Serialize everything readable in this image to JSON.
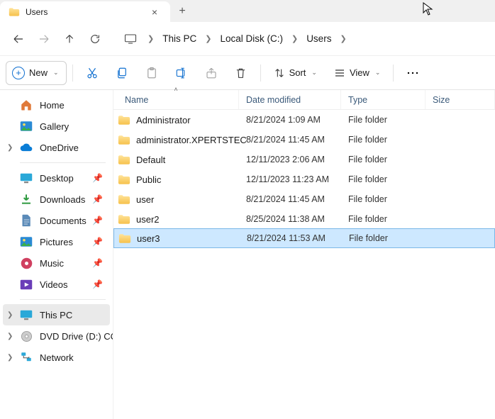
{
  "tab": {
    "title": "Users"
  },
  "breadcrumb": {
    "thispc": "This PC",
    "drive": "Local Disk (C:)",
    "folder": "Users"
  },
  "toolbar": {
    "new": "New",
    "sort": "Sort",
    "view": "View"
  },
  "sidebar": {
    "home": "Home",
    "gallery": "Gallery",
    "onedrive": "OneDrive",
    "desktop": "Desktop",
    "downloads": "Downloads",
    "documents": "Documents",
    "pictures": "Pictures",
    "music": "Music",
    "videos": "Videos",
    "thispc": "This PC",
    "dvd": "DVD Drive (D:) CCC",
    "network": "Network"
  },
  "columns": {
    "name": "Name",
    "date": "Date modified",
    "type": "Type",
    "size": "Size"
  },
  "rows": [
    {
      "name": "Administrator",
      "date": "8/21/2024 1:09 AM",
      "type": "File folder"
    },
    {
      "name": "administrator.XPERTSTEC",
      "date": "8/21/2024 11:45 AM",
      "type": "File folder"
    },
    {
      "name": "Default",
      "date": "12/11/2023 2:06 AM",
      "type": "File folder"
    },
    {
      "name": "Public",
      "date": "12/11/2023 11:23 AM",
      "type": "File folder"
    },
    {
      "name": "user",
      "date": "8/21/2024 11:45 AM",
      "type": "File folder"
    },
    {
      "name": "user2",
      "date": "8/25/2024 11:38 AM",
      "type": "File folder"
    },
    {
      "name": "user3",
      "date": "8/21/2024 11:53 AM",
      "type": "File folder"
    }
  ],
  "selected_index": 6
}
